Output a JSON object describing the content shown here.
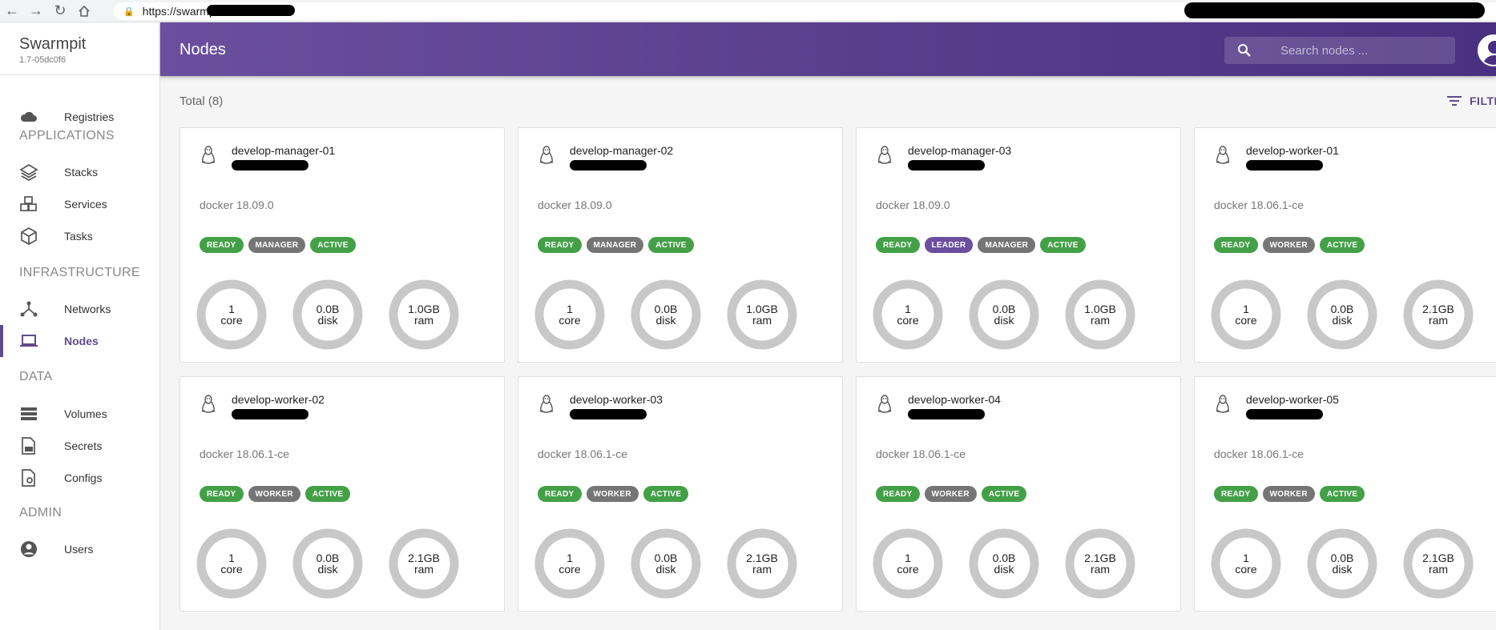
{
  "browser": {
    "url": "https://swarmpit.",
    "nav_icons": [
      "back-icon",
      "forward-icon",
      "reload-icon",
      "home-icon"
    ]
  },
  "app": {
    "name": "Swarmpit",
    "version": "1.7-05dc0f6"
  },
  "sidebar": {
    "items": [
      {
        "label": "Registries",
        "icon": "cloud-icon"
      },
      {
        "label": "Stacks",
        "icon": "layers-icon"
      },
      {
        "label": "Services",
        "icon": "cubes-icon"
      },
      {
        "label": "Tasks",
        "icon": "cube-icon"
      },
      {
        "label": "Networks",
        "icon": "network-icon"
      },
      {
        "label": "Nodes",
        "icon": "laptop-icon",
        "active": true
      },
      {
        "label": "Volumes",
        "icon": "storage-icon"
      },
      {
        "label": "Secrets",
        "icon": "secret-icon"
      },
      {
        "label": "Configs",
        "icon": "config-icon"
      },
      {
        "label": "Users",
        "icon": "account-icon"
      }
    ],
    "sections": [
      "APPLICATIONS",
      "INFRASTRUCTURE",
      "DATA",
      "ADMIN"
    ]
  },
  "header": {
    "title": "Nodes",
    "search_placeholder": "Search nodes ..."
  },
  "main": {
    "total": "Total (8)",
    "filter_label": "FILTE"
  },
  "colors": {
    "accent": "#5f4b8b",
    "ready": "#43a047",
    "role": "#757575",
    "leader": "#6b4f9e",
    "gauge_track": "#c8c8c8"
  },
  "nodes": [
    {
      "name": "develop-manager-01",
      "version": "docker 18.09.0",
      "labels": [
        "READY",
        "MANAGER",
        "ACTIVE"
      ],
      "cpu": "1",
      "cpu_unit": "core",
      "disk": "0.0B",
      "disk_unit": "disk",
      "ram": "1.0GB",
      "ram_unit": "ram"
    },
    {
      "name": "develop-manager-02",
      "version": "docker 18.09.0",
      "labels": [
        "READY",
        "MANAGER",
        "ACTIVE"
      ],
      "cpu": "1",
      "cpu_unit": "core",
      "disk": "0.0B",
      "disk_unit": "disk",
      "ram": "1.0GB",
      "ram_unit": "ram"
    },
    {
      "name": "develop-manager-03",
      "version": "docker 18.09.0",
      "labels": [
        "READY",
        "LEADER",
        "MANAGER",
        "ACTIVE"
      ],
      "cpu": "1",
      "cpu_unit": "core",
      "disk": "0.0B",
      "disk_unit": "disk",
      "ram": "1.0GB",
      "ram_unit": "ram"
    },
    {
      "name": "develop-worker-01",
      "version": "docker 18.06.1-ce",
      "labels": [
        "READY",
        "WORKER",
        "ACTIVE"
      ],
      "cpu": "1",
      "cpu_unit": "core",
      "disk": "0.0B",
      "disk_unit": "disk",
      "ram": "2.1GB",
      "ram_unit": "ram"
    },
    {
      "name": "develop-worker-02",
      "version": "docker 18.06.1-ce",
      "labels": [
        "READY",
        "WORKER",
        "ACTIVE"
      ],
      "cpu": "1",
      "cpu_unit": "core",
      "disk": "0.0B",
      "disk_unit": "disk",
      "ram": "2.1GB",
      "ram_unit": "ram"
    },
    {
      "name": "develop-worker-03",
      "version": "docker 18.06.1-ce",
      "labels": [
        "READY",
        "WORKER",
        "ACTIVE"
      ],
      "cpu": "1",
      "cpu_unit": "core",
      "disk": "0.0B",
      "disk_unit": "disk",
      "ram": "2.1GB",
      "ram_unit": "ram"
    },
    {
      "name": "develop-worker-04",
      "version": "docker 18.06.1-ce",
      "labels": [
        "READY",
        "WORKER",
        "ACTIVE"
      ],
      "cpu": "1",
      "cpu_unit": "core",
      "disk": "0.0B",
      "disk_unit": "disk",
      "ram": "2.1GB",
      "ram_unit": "ram"
    },
    {
      "name": "develop-worker-05",
      "version": "docker 18.06.1-ce",
      "labels": [
        "READY",
        "WORKER",
        "ACTIVE"
      ],
      "cpu": "1",
      "cpu_unit": "core",
      "disk": "0.0B",
      "disk_unit": "disk",
      "ram": "2.1GB",
      "ram_unit": "ram"
    }
  ]
}
